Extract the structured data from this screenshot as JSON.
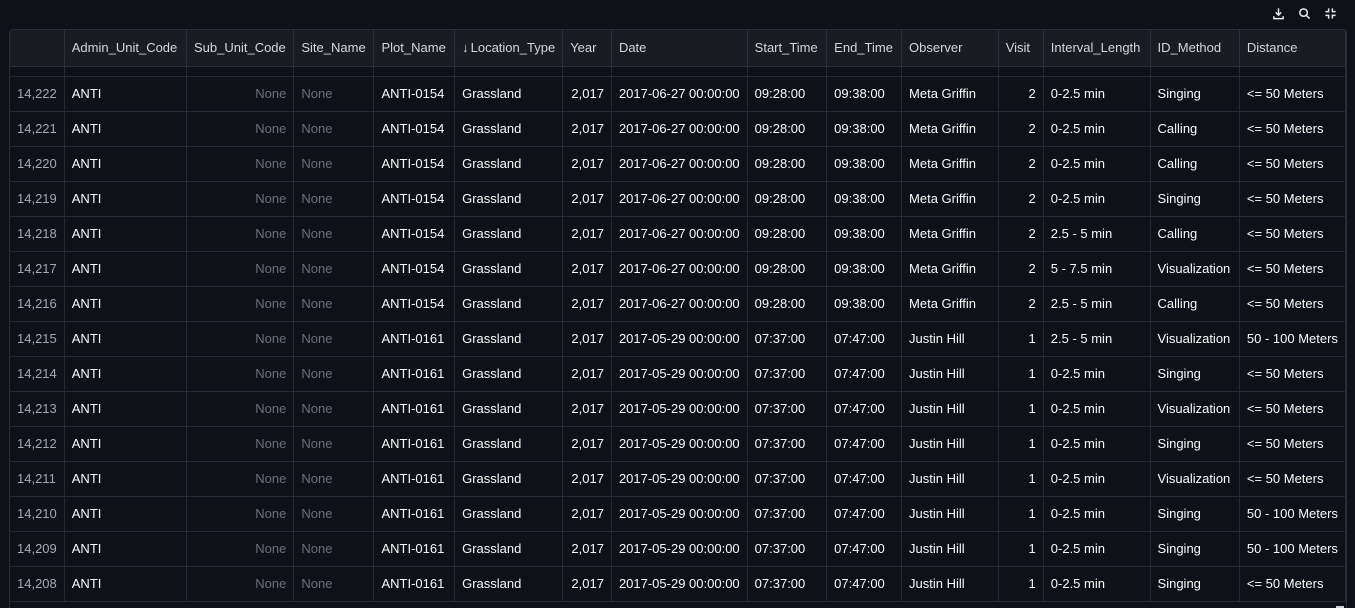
{
  "toolbar": {
    "download_icon": "download-icon",
    "search_icon": "search-icon",
    "fullscreen_icon": "fullscreen-icon"
  },
  "columns": [
    {
      "label": ""
    },
    {
      "label": "Admin_Unit_Code"
    },
    {
      "label": "Sub_Unit_Code"
    },
    {
      "label": "Site_Name"
    },
    {
      "label": "Plot_Name"
    },
    {
      "label": "Location_Type",
      "sorted": "desc",
      "sort_glyph": "↓"
    },
    {
      "label": "Year"
    },
    {
      "label": "Date"
    },
    {
      "label": "Start_Time"
    },
    {
      "label": "End_Time"
    },
    {
      "label": "Observer"
    },
    {
      "label": "Visit"
    },
    {
      "label": "Interval_Length"
    },
    {
      "label": "ID_Method"
    },
    {
      "label": "Distance"
    }
  ],
  "rows": [
    [
      "14,222",
      "ANTI",
      "None",
      "None",
      "ANTI-0154",
      "Grassland",
      "2,017",
      "2017-06-27 00:00:00",
      "09:28:00",
      "09:38:00",
      "Meta Griffin",
      "2",
      "0-2.5 min",
      "Singing",
      "<= 50 Meters"
    ],
    [
      "14,221",
      "ANTI",
      "None",
      "None",
      "ANTI-0154",
      "Grassland",
      "2,017",
      "2017-06-27 00:00:00",
      "09:28:00",
      "09:38:00",
      "Meta Griffin",
      "2",
      "0-2.5 min",
      "Calling",
      "<= 50 Meters"
    ],
    [
      "14,220",
      "ANTI",
      "None",
      "None",
      "ANTI-0154",
      "Grassland",
      "2,017",
      "2017-06-27 00:00:00",
      "09:28:00",
      "09:38:00",
      "Meta Griffin",
      "2",
      "0-2.5 min",
      "Calling",
      "<= 50 Meters"
    ],
    [
      "14,219",
      "ANTI",
      "None",
      "None",
      "ANTI-0154",
      "Grassland",
      "2,017",
      "2017-06-27 00:00:00",
      "09:28:00",
      "09:38:00",
      "Meta Griffin",
      "2",
      "0-2.5 min",
      "Singing",
      "<= 50 Meters"
    ],
    [
      "14,218",
      "ANTI",
      "None",
      "None",
      "ANTI-0154",
      "Grassland",
      "2,017",
      "2017-06-27 00:00:00",
      "09:28:00",
      "09:38:00",
      "Meta Griffin",
      "2",
      "2.5 - 5 min",
      "Calling",
      "<= 50 Meters"
    ],
    [
      "14,217",
      "ANTI",
      "None",
      "None",
      "ANTI-0154",
      "Grassland",
      "2,017",
      "2017-06-27 00:00:00",
      "09:28:00",
      "09:38:00",
      "Meta Griffin",
      "2",
      "5 - 7.5 min",
      "Visualization",
      "<= 50 Meters"
    ],
    [
      "14,216",
      "ANTI",
      "None",
      "None",
      "ANTI-0154",
      "Grassland",
      "2,017",
      "2017-06-27 00:00:00",
      "09:28:00",
      "09:38:00",
      "Meta Griffin",
      "2",
      "2.5 - 5 min",
      "Calling",
      "<= 50 Meters"
    ],
    [
      "14,215",
      "ANTI",
      "None",
      "None",
      "ANTI-0161",
      "Grassland",
      "2,017",
      "2017-05-29 00:00:00",
      "07:37:00",
      "07:47:00",
      "Justin Hill",
      "1",
      "2.5 - 5 min",
      "Visualization",
      "50 - 100 Meters"
    ],
    [
      "14,214",
      "ANTI",
      "None",
      "None",
      "ANTI-0161",
      "Grassland",
      "2,017",
      "2017-05-29 00:00:00",
      "07:37:00",
      "07:47:00",
      "Justin Hill",
      "1",
      "0-2.5 min",
      "Singing",
      "<= 50 Meters"
    ],
    [
      "14,213",
      "ANTI",
      "None",
      "None",
      "ANTI-0161",
      "Grassland",
      "2,017",
      "2017-05-29 00:00:00",
      "07:37:00",
      "07:47:00",
      "Justin Hill",
      "1",
      "0-2.5 min",
      "Visualization",
      "<= 50 Meters"
    ],
    [
      "14,212",
      "ANTI",
      "None",
      "None",
      "ANTI-0161",
      "Grassland",
      "2,017",
      "2017-05-29 00:00:00",
      "07:37:00",
      "07:47:00",
      "Justin Hill",
      "1",
      "0-2.5 min",
      "Singing",
      "<= 50 Meters"
    ],
    [
      "14,211",
      "ANTI",
      "None",
      "None",
      "ANTI-0161",
      "Grassland",
      "2,017",
      "2017-05-29 00:00:00",
      "07:37:00",
      "07:47:00",
      "Justin Hill",
      "1",
      "0-2.5 min",
      "Visualization",
      "<= 50 Meters"
    ],
    [
      "14,210",
      "ANTI",
      "None",
      "None",
      "ANTI-0161",
      "Grassland",
      "2,017",
      "2017-05-29 00:00:00",
      "07:37:00",
      "07:47:00",
      "Justin Hill",
      "1",
      "0-2.5 min",
      "Singing",
      "50 - 100 Meters"
    ],
    [
      "14,209",
      "ANTI",
      "None",
      "None",
      "ANTI-0161",
      "Grassland",
      "2,017",
      "2017-05-29 00:00:00",
      "07:37:00",
      "07:47:00",
      "Justin Hill",
      "1",
      "0-2.5 min",
      "Singing",
      "50 - 100 Meters"
    ],
    [
      "14,208",
      "ANTI",
      "None",
      "None",
      "ANTI-0161",
      "Grassland",
      "2,017",
      "2017-05-29 00:00:00",
      "07:37:00",
      "07:47:00",
      "Justin Hill",
      "1",
      "0-2.5 min",
      "Singing",
      "<= 50 Meters"
    ]
  ]
}
